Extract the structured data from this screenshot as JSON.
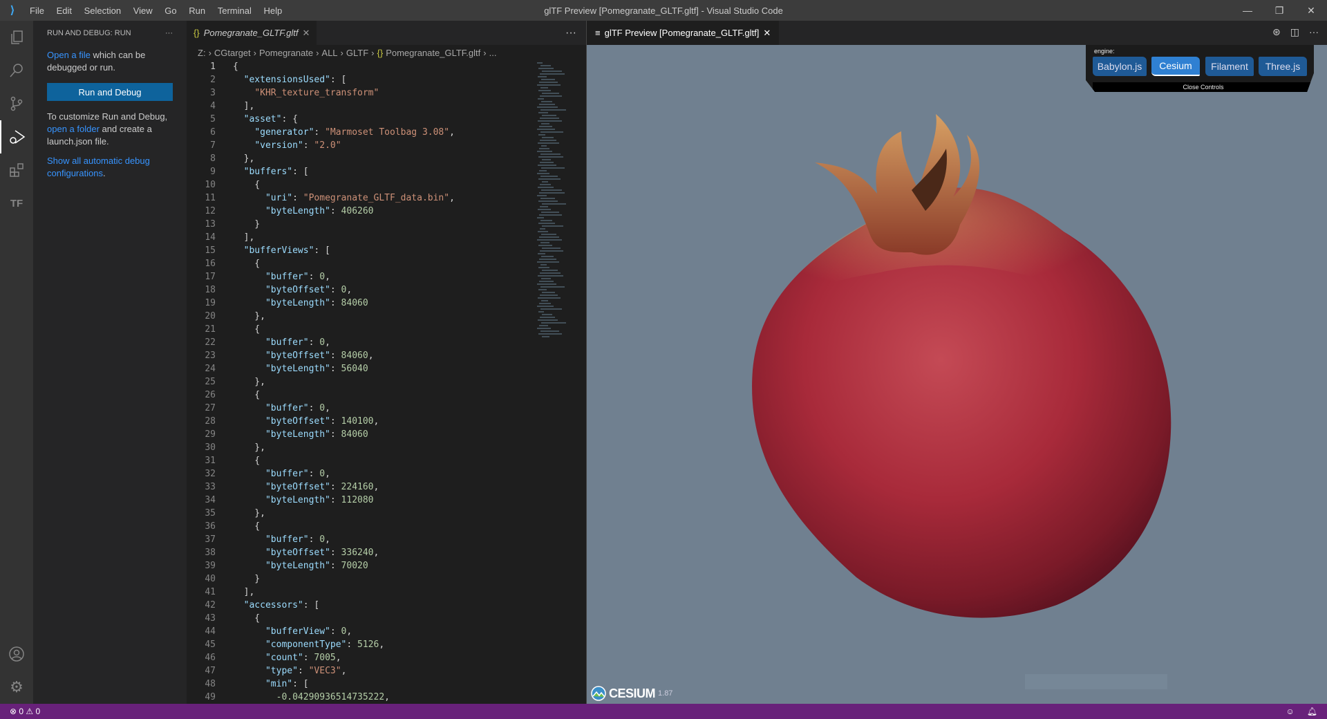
{
  "titlebar": {
    "menu": [
      "File",
      "Edit",
      "Selection",
      "View",
      "Go",
      "Run",
      "Terminal",
      "Help"
    ],
    "title": "glTF Preview [Pomegranate_GLTF.gltf] - Visual Studio Code"
  },
  "sidebar": {
    "header": "RUN AND DEBUG: RUN",
    "open_file_link": "Open a file",
    "open_file_rest": " which can be debugged or run.",
    "run_button": "Run and Debug",
    "customize_text": "To customize Run and Debug, ",
    "open_folder_link": "open a folder",
    "customize_rest": " and create a launch.json file.",
    "show_all_link": "Show all automatic debug configurations",
    "show_all_end": "."
  },
  "editor": {
    "tab": "Pomegranate_GLTF.gltf",
    "breadcrumbs": [
      "Z:",
      "CGtarget",
      "Pomegranate",
      "ALL",
      "GLTF",
      "Pomegranate_GLTF.gltf",
      "..."
    ],
    "lines": [
      [
        [
          "p",
          "{"
        ]
      ],
      [
        [
          "p",
          "  "
        ],
        [
          "k",
          "\"extensionsUsed\""
        ],
        [
          "p",
          ": ["
        ]
      ],
      [
        [
          "p",
          "    "
        ],
        [
          "s",
          "\"KHR_texture_transform\""
        ]
      ],
      [
        [
          "p",
          "  ],"
        ]
      ],
      [
        [
          "p",
          "  "
        ],
        [
          "k",
          "\"asset\""
        ],
        [
          "p",
          ": {"
        ]
      ],
      [
        [
          "p",
          "    "
        ],
        [
          "k",
          "\"generator\""
        ],
        [
          "p",
          ": "
        ],
        [
          "s",
          "\"Marmoset Toolbag 3.08\""
        ],
        [
          "p",
          ","
        ]
      ],
      [
        [
          "p",
          "    "
        ],
        [
          "k",
          "\"version\""
        ],
        [
          "p",
          ": "
        ],
        [
          "s",
          "\"2.0\""
        ]
      ],
      [
        [
          "p",
          "  },"
        ]
      ],
      [
        [
          "p",
          "  "
        ],
        [
          "k",
          "\"buffers\""
        ],
        [
          "p",
          ": ["
        ]
      ],
      [
        [
          "p",
          "    {"
        ]
      ],
      [
        [
          "p",
          "      "
        ],
        [
          "k",
          "\"uri\""
        ],
        [
          "p",
          ": "
        ],
        [
          "s",
          "\"Pomegranate_GLTF_data.bin\""
        ],
        [
          "p",
          ","
        ]
      ],
      [
        [
          "p",
          "      "
        ],
        [
          "k",
          "\"byteLength\""
        ],
        [
          "p",
          ": "
        ],
        [
          "n",
          "406260"
        ]
      ],
      [
        [
          "p",
          "    }"
        ]
      ],
      [
        [
          "p",
          "  ],"
        ]
      ],
      [
        [
          "p",
          "  "
        ],
        [
          "k",
          "\"bufferViews\""
        ],
        [
          "p",
          ": ["
        ]
      ],
      [
        [
          "p",
          "    {"
        ]
      ],
      [
        [
          "p",
          "      "
        ],
        [
          "k",
          "\"buffer\""
        ],
        [
          "p",
          ": "
        ],
        [
          "n",
          "0"
        ],
        [
          "p",
          ","
        ]
      ],
      [
        [
          "p",
          "      "
        ],
        [
          "k",
          "\"byteOffset\""
        ],
        [
          "p",
          ": "
        ],
        [
          "n",
          "0"
        ],
        [
          "p",
          ","
        ]
      ],
      [
        [
          "p",
          "      "
        ],
        [
          "k",
          "\"byteLength\""
        ],
        [
          "p",
          ": "
        ],
        [
          "n",
          "84060"
        ]
      ],
      [
        [
          "p",
          "    },"
        ]
      ],
      [
        [
          "p",
          "    {"
        ]
      ],
      [
        [
          "p",
          "      "
        ],
        [
          "k",
          "\"buffer\""
        ],
        [
          "p",
          ": "
        ],
        [
          "n",
          "0"
        ],
        [
          "p",
          ","
        ]
      ],
      [
        [
          "p",
          "      "
        ],
        [
          "k",
          "\"byteOffset\""
        ],
        [
          "p",
          ": "
        ],
        [
          "n",
          "84060"
        ],
        [
          "p",
          ","
        ]
      ],
      [
        [
          "p",
          "      "
        ],
        [
          "k",
          "\"byteLength\""
        ],
        [
          "p",
          ": "
        ],
        [
          "n",
          "56040"
        ]
      ],
      [
        [
          "p",
          "    },"
        ]
      ],
      [
        [
          "p",
          "    {"
        ]
      ],
      [
        [
          "p",
          "      "
        ],
        [
          "k",
          "\"buffer\""
        ],
        [
          "p",
          ": "
        ],
        [
          "n",
          "0"
        ],
        [
          "p",
          ","
        ]
      ],
      [
        [
          "p",
          "      "
        ],
        [
          "k",
          "\"byteOffset\""
        ],
        [
          "p",
          ": "
        ],
        [
          "n",
          "140100"
        ],
        [
          "p",
          ","
        ]
      ],
      [
        [
          "p",
          "      "
        ],
        [
          "k",
          "\"byteLength\""
        ],
        [
          "p",
          ": "
        ],
        [
          "n",
          "84060"
        ]
      ],
      [
        [
          "p",
          "    },"
        ]
      ],
      [
        [
          "p",
          "    {"
        ]
      ],
      [
        [
          "p",
          "      "
        ],
        [
          "k",
          "\"buffer\""
        ],
        [
          "p",
          ": "
        ],
        [
          "n",
          "0"
        ],
        [
          "p",
          ","
        ]
      ],
      [
        [
          "p",
          "      "
        ],
        [
          "k",
          "\"byteOffset\""
        ],
        [
          "p",
          ": "
        ],
        [
          "n",
          "224160"
        ],
        [
          "p",
          ","
        ]
      ],
      [
        [
          "p",
          "      "
        ],
        [
          "k",
          "\"byteLength\""
        ],
        [
          "p",
          ": "
        ],
        [
          "n",
          "112080"
        ]
      ],
      [
        [
          "p",
          "    },"
        ]
      ],
      [
        [
          "p",
          "    {"
        ]
      ],
      [
        [
          "p",
          "      "
        ],
        [
          "k",
          "\"buffer\""
        ],
        [
          "p",
          ": "
        ],
        [
          "n",
          "0"
        ],
        [
          "p",
          ","
        ]
      ],
      [
        [
          "p",
          "      "
        ],
        [
          "k",
          "\"byteOffset\""
        ],
        [
          "p",
          ": "
        ],
        [
          "n",
          "336240"
        ],
        [
          "p",
          ","
        ]
      ],
      [
        [
          "p",
          "      "
        ],
        [
          "k",
          "\"byteLength\""
        ],
        [
          "p",
          ": "
        ],
        [
          "n",
          "70020"
        ]
      ],
      [
        [
          "p",
          "    }"
        ]
      ],
      [
        [
          "p",
          "  ],"
        ]
      ],
      [
        [
          "p",
          "  "
        ],
        [
          "k",
          "\"accessors\""
        ],
        [
          "p",
          ": ["
        ]
      ],
      [
        [
          "p",
          "    {"
        ]
      ],
      [
        [
          "p",
          "      "
        ],
        [
          "k",
          "\"bufferView\""
        ],
        [
          "p",
          ": "
        ],
        [
          "n",
          "0"
        ],
        [
          "p",
          ","
        ]
      ],
      [
        [
          "p",
          "      "
        ],
        [
          "k",
          "\"componentType\""
        ],
        [
          "p",
          ": "
        ],
        [
          "n",
          "5126"
        ],
        [
          "p",
          ","
        ]
      ],
      [
        [
          "p",
          "      "
        ],
        [
          "k",
          "\"count\""
        ],
        [
          "p",
          ": "
        ],
        [
          "n",
          "7005"
        ],
        [
          "p",
          ","
        ]
      ],
      [
        [
          "p",
          "      "
        ],
        [
          "k",
          "\"type\""
        ],
        [
          "p",
          ": "
        ],
        [
          "s",
          "\"VEC3\""
        ],
        [
          "p",
          ","
        ]
      ],
      [
        [
          "p",
          "      "
        ],
        [
          "k",
          "\"min\""
        ],
        [
          "p",
          ": ["
        ]
      ],
      [
        [
          "p",
          "        "
        ],
        [
          "n",
          "-0.04290936514735222"
        ],
        [
          "p",
          ","
        ]
      ]
    ]
  },
  "preview": {
    "tab": "glTF Preview [Pomegranate_GLTF.gltf]",
    "engine_label": "engine:",
    "engines": [
      "Babylon.js",
      "Cesium",
      "Filament",
      "Three.js"
    ],
    "active_engine": "Cesium",
    "close_controls": "Close Controls",
    "cesium_logo": "CESIUM",
    "cesium_version": "1.87"
  },
  "status": {
    "errors": "0",
    "warnings": "0"
  },
  "colors": {
    "statusbar": "#68217a",
    "accent": "#0e639c",
    "viewport": "#708090"
  }
}
